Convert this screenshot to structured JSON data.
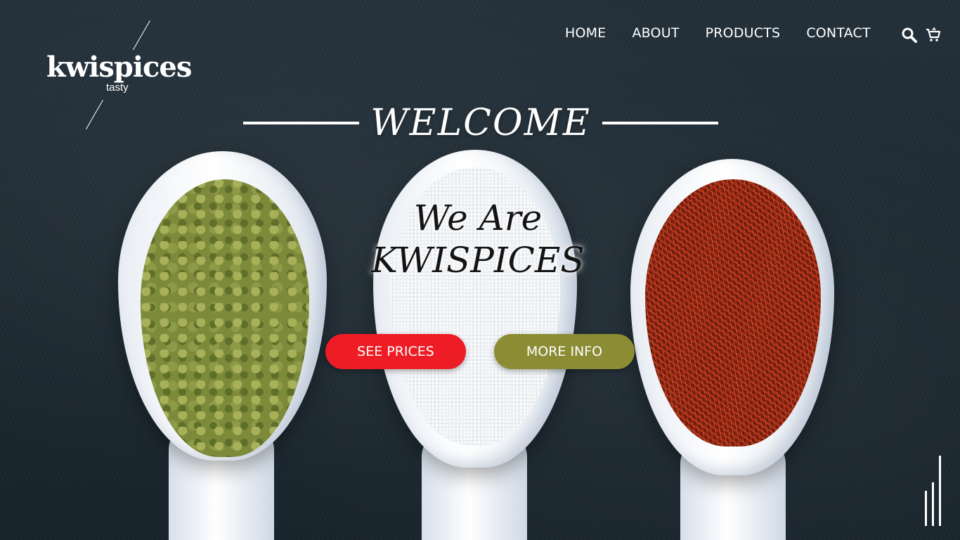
{
  "brand": {
    "name": "kwispices",
    "tagline": "tasty"
  },
  "nav": {
    "items": [
      {
        "label": "HOME"
      },
      {
        "label": "ABOUT"
      },
      {
        "label": "PRODUCTS"
      },
      {
        "label": "CONTACT"
      }
    ],
    "icons": [
      "search-icon",
      "cart-icon"
    ]
  },
  "hero": {
    "welcome": "WELCOME",
    "line1": "We Are",
    "line2": "KWISPICES"
  },
  "buttons": {
    "prices": "SEE PRICES",
    "info": "MORE INFO"
  },
  "colors": {
    "prices_button": "#ee1c25",
    "info_button": "#8b8c33",
    "background": "#1d2a33",
    "text_light": "#ffffff"
  }
}
